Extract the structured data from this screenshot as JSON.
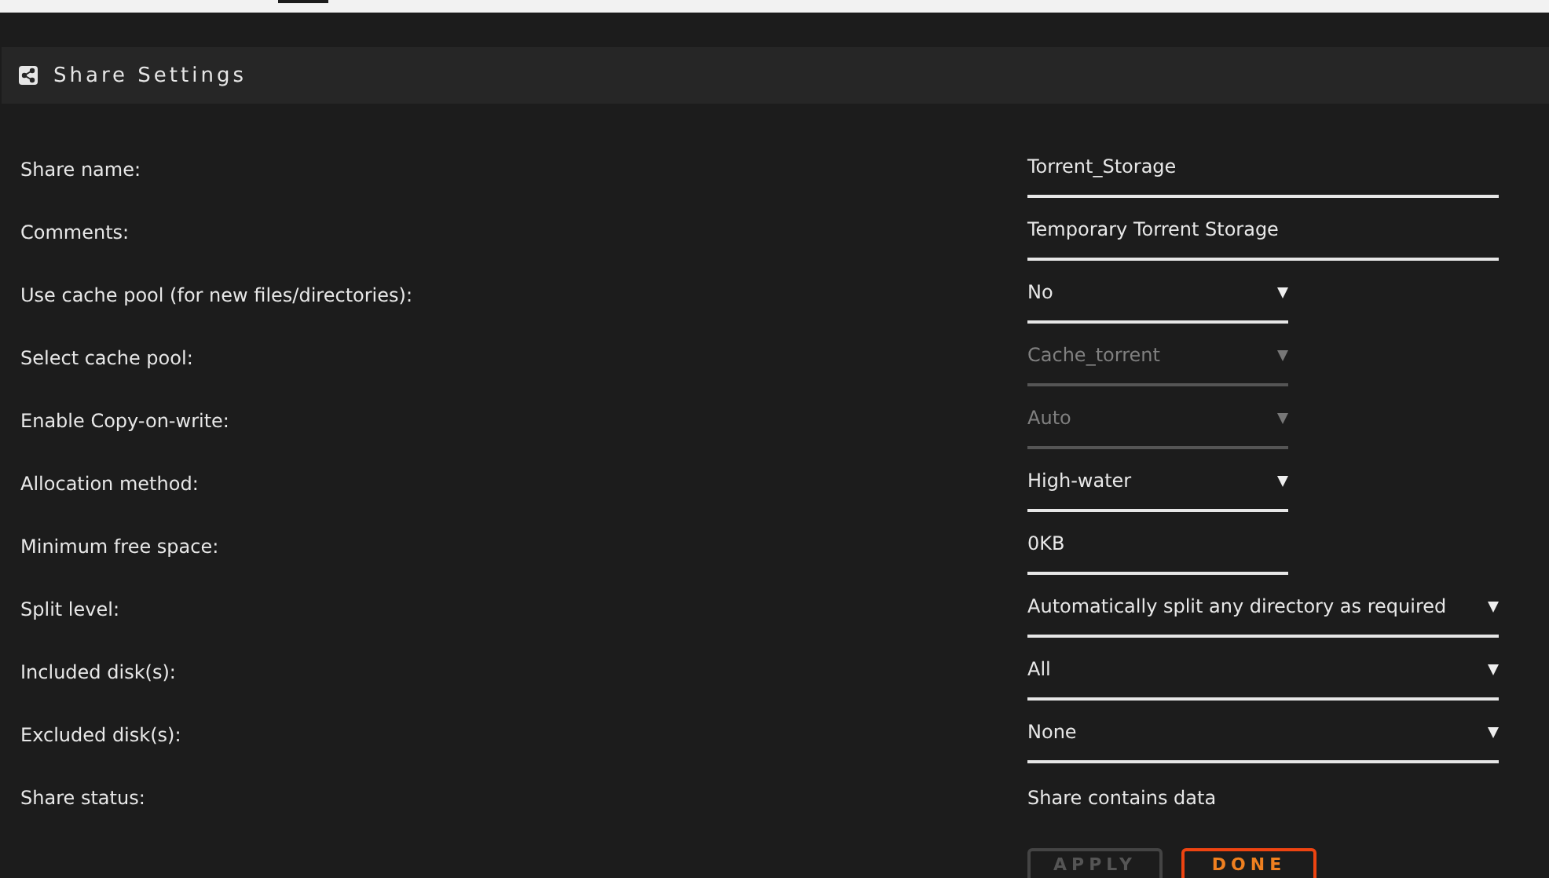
{
  "header": {
    "title": "Share Settings"
  },
  "fields": [
    {
      "label": "Share name:",
      "kind": "input",
      "value": "Torrent_Storage",
      "wide": true
    },
    {
      "label": "Comments:",
      "kind": "input",
      "value": "Temporary Torrent Storage",
      "wide": true
    },
    {
      "label": "Use cache pool (for new files/directories):",
      "kind": "select",
      "value": "No",
      "wide": false,
      "disabled": false
    },
    {
      "label": "Select cache pool:",
      "kind": "select",
      "value": "Cache_torrent",
      "wide": false,
      "disabled": true
    },
    {
      "label": "Enable Copy-on-write:",
      "kind": "select",
      "value": "Auto",
      "wide": false,
      "disabled": true
    },
    {
      "label": "Allocation method:",
      "kind": "select",
      "value": "High-water",
      "wide": false,
      "disabled": false
    },
    {
      "label": "Minimum free space:",
      "kind": "input",
      "value": "0KB",
      "wide": false
    },
    {
      "label": "Split level:",
      "kind": "select",
      "value": "Automatically split any directory as required",
      "wide": true,
      "disabled": false
    },
    {
      "label": "Included disk(s):",
      "kind": "select",
      "value": "All",
      "wide": true,
      "disabled": false
    },
    {
      "label": "Excluded disk(s):",
      "kind": "select",
      "value": "None",
      "wide": true,
      "disabled": false
    },
    {
      "label": "Share status:",
      "kind": "text",
      "value": "Share contains data"
    }
  ],
  "buttons": [
    {
      "label": "APPLY",
      "disabled": true
    },
    {
      "label": "DONE",
      "disabled": false
    }
  ]
}
